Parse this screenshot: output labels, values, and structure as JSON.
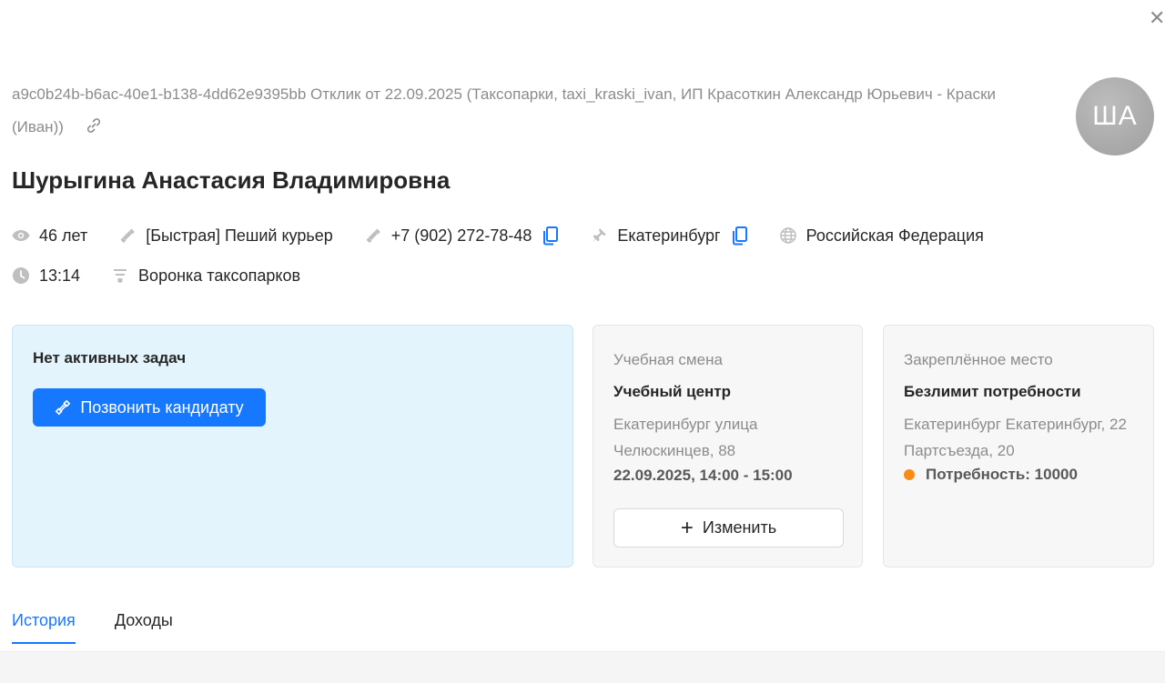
{
  "header": {
    "meta_text": "a9c0b24b-b6ac-40e1-b138-4dd62e9395bb Отклик от 22.09.2025 (Таксопарки, taxi_kraski_ivan, ИП Красоткин Александр Юрьевич - Краски (Иван))",
    "avatar_initials": "ША",
    "candidate_name": "Шурыгина Анастасия Владимировна"
  },
  "info": {
    "age": "46 лет",
    "vacancy": "[Быстрая] Пеший курьер",
    "phone": "+7 (902) 272-78-48",
    "city": "Екатеринбург",
    "country": "Российская Федерация",
    "time": "13:14",
    "funnel": "Воронка таксопарков"
  },
  "tasks_card": {
    "title": "Нет активных задач",
    "call_button": "Позвонить кандидату"
  },
  "shift_card": {
    "label": "Учебная смена",
    "title": "Учебный центр",
    "address": "Екатеринбург улица Челюскинцев, 88",
    "time": "22.09.2025, 14:00 - 15:00",
    "edit_button": "Изменить"
  },
  "place_card": {
    "label": "Закреплённое место",
    "title": "Безлимит потребности",
    "address": "Екатеринбург Екатеринбург, 22 Партсъезда, 20",
    "need": "Потребность: 10000"
  },
  "tabs": [
    {
      "label": "История",
      "active": true
    },
    {
      "label": "Доходы",
      "active": false
    }
  ],
  "colors": {
    "accent": "#1677ff",
    "tasks_bg": "#e3f4fd",
    "need_dot": "#fa8c16"
  }
}
